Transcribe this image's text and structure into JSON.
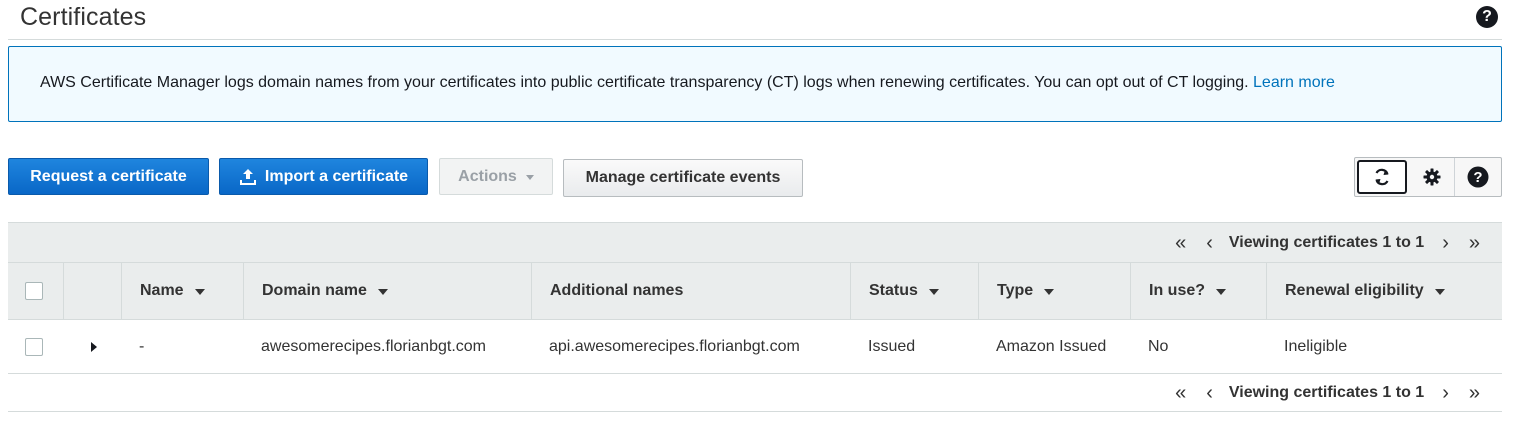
{
  "page": {
    "title": "Certificates",
    "help_icon": "question-circle-icon"
  },
  "info": {
    "text": "AWS Certificate Manager logs domain names from your certificates into public certificate transparency (CT) logs when renewing certificates. You can opt out of CT logging.",
    "link": "Learn more"
  },
  "toolbar": {
    "request_label": "Request a certificate",
    "import_label": "Import a certificate",
    "actions_label": "Actions",
    "manage_label": "Manage certificate events",
    "icons": [
      "refresh-icon",
      "gear-icon",
      "question-circle-icon"
    ]
  },
  "pagination": {
    "label": "Viewing certificates 1 to 1",
    "first": "«",
    "prev": "‹",
    "next": "›",
    "last": "»"
  },
  "table": {
    "columns": [
      "Name",
      "Domain name",
      "Additional names",
      "Status",
      "Type",
      "In use?",
      "Renewal eligibility"
    ],
    "rows": [
      {
        "name": "-",
        "domain": "awesomerecipes.florianbgt.com",
        "additional": "api.awesomerecipes.florianbgt.com",
        "status": "Issued",
        "type": "Amazon Issued",
        "in_use": "No",
        "renewal": "Ineligible"
      }
    ]
  },
  "colors": {
    "primary": "#0a6fd0",
    "link": "#0073bb",
    "success": "#1d8102",
    "info_bg": "#f1faff"
  }
}
